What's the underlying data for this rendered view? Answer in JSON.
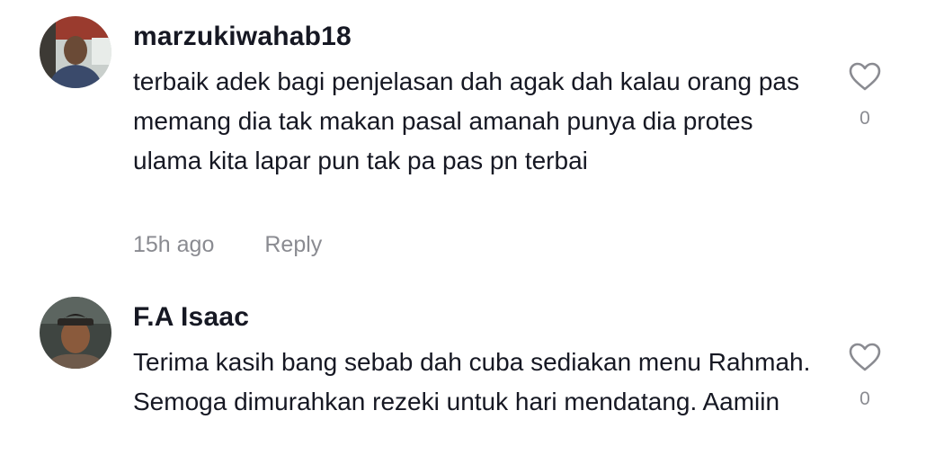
{
  "comments": [
    {
      "username": "marzukiwahab18",
      "text": "terbaik adek bagi penjelasan dah agak dah kalau orang pas memang dia tak makan pasal amanah punya dia protes ulama kita lapar pun tak pa pas pn terbai",
      "time": "15h ago",
      "reply_label": "Reply",
      "likes": "0",
      "avatar_icon": "user-avatar-photo"
    },
    {
      "username": "F.A Isaac",
      "text": "Terima kasih bang sebab dah cuba sediakan menu Rahmah. Semoga dimurahkan rezeki untuk hari mendatang. Aamiin",
      "likes": "0",
      "avatar_icon": "user-avatar-photo"
    }
  ],
  "icons": {
    "like": "heart-outline-icon"
  },
  "colors": {
    "text": "#161823",
    "secondary": "#8a8b91",
    "background": "#ffffff"
  }
}
